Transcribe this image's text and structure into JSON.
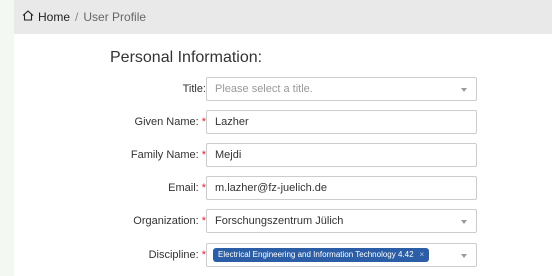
{
  "breadcrumb": {
    "home_icon": "home-icon",
    "home_label": "Home",
    "separator": "/",
    "current": "User Profile"
  },
  "section": {
    "title": "Personal Information:"
  },
  "form": {
    "title_label": "Title:",
    "title_placeholder": "Please select a title.",
    "given_name_label": "Given Name:",
    "given_name_value": "Lazher",
    "family_name_label": "Family Name:",
    "family_name_value": "Mejdi",
    "email_label": "Email:",
    "email_value": "m.lazher@fz-juelich.de",
    "organization_label": "Organization:",
    "organization_value": "Forschungszentrum Jülich",
    "discipline_label": "Discipline:",
    "discipline_tag": "Electrical Engineering and Information Technology 4.42",
    "discipline_tag_remove": "×",
    "required_marker": "*"
  },
  "colors": {
    "required": "#d9232d",
    "tag_background": "#2b5ea6",
    "breadcrumb_bar": "#e9e9e9"
  }
}
